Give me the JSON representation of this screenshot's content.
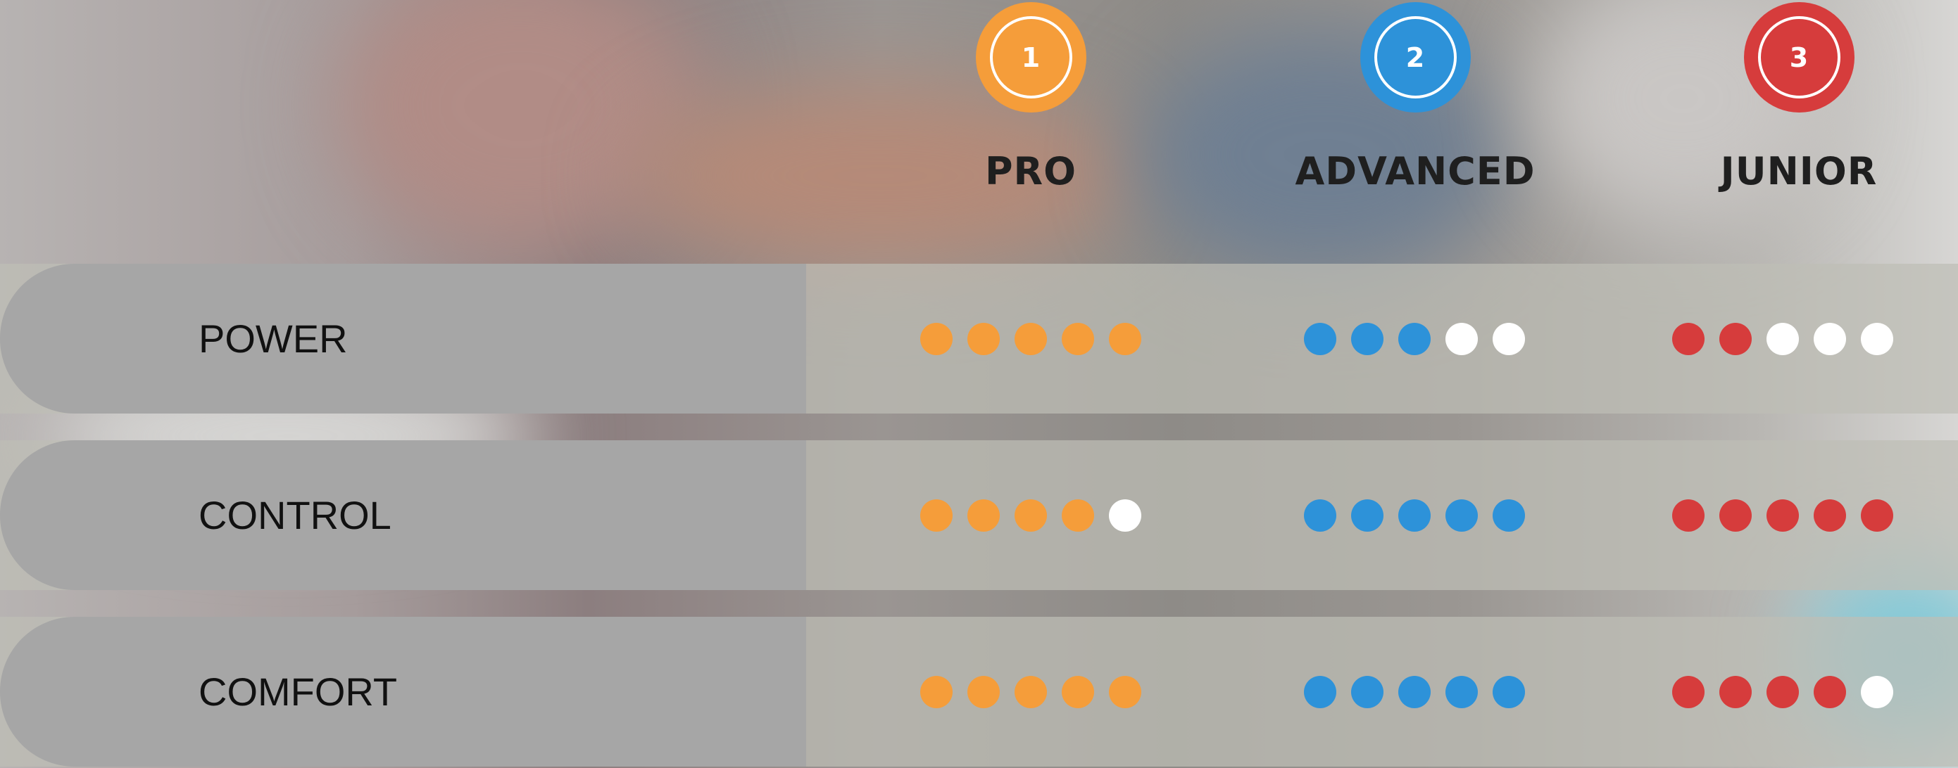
{
  "colors": {
    "pro": "#f59d3a",
    "advanced": "#2d92d9",
    "junior": "#d63c3c",
    "empty": "#ffffff"
  },
  "tiers": [
    {
      "key": "pro",
      "number": "1",
      "name": "PRO"
    },
    {
      "key": "advanced",
      "number": "2",
      "name": "ADVANCED"
    },
    {
      "key": "junior",
      "number": "3",
      "name": "JUNIOR"
    }
  ],
  "rows": [
    {
      "label": "POWER",
      "ratings": {
        "pro": 5,
        "advanced": 3,
        "junior": 2
      }
    },
    {
      "label": "CONTROL",
      "ratings": {
        "pro": 4,
        "advanced": 5,
        "junior": 5
      }
    },
    {
      "label": "COMFORT",
      "ratings": {
        "pro": 5,
        "advanced": 5,
        "junior": 4
      }
    }
  ],
  "max_rating": 5
}
